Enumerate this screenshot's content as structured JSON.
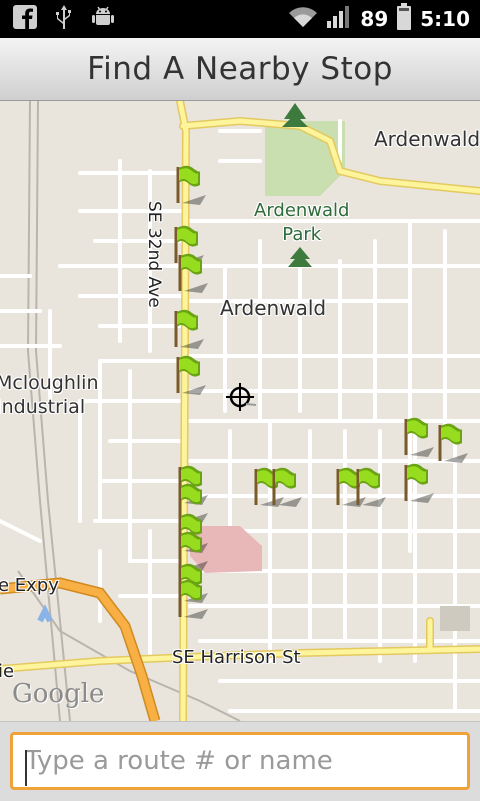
{
  "status_bar": {
    "icons": [
      "facebook-icon",
      "usb-icon",
      "android-debug-icon",
      "wifi-icon",
      "signal-icon",
      "battery-icon"
    ],
    "battery": "89",
    "time": "5:10"
  },
  "header": {
    "title": "Find A Nearby Stop"
  },
  "map": {
    "labels": {
      "ardenwald_ne": "Ardenwald",
      "park_line1": "Ardenwald",
      "park_line2": "Park",
      "ardenwald_center": "Ardenwald",
      "mcloughlin_line1": "Mcloughlin",
      "mcloughlin_line2": "Industrial",
      "expy": "e Expy",
      "harrison": "SE Harrison St",
      "ave32": "SE 32nd Ave",
      "ie": "ie"
    },
    "attribution": "Google",
    "stop_icon": "stop-flag-icon",
    "center_icon": "crosshair-icon",
    "colors": {
      "land": "#e9e5dc",
      "minor_road": "#ffffff",
      "major_road": "#fdf49c",
      "highway": "#f8b044",
      "park": "#c9dfaf",
      "flag": "#8fd11a"
    }
  },
  "search": {
    "placeholder": "Type a route # or name",
    "value": ""
  }
}
